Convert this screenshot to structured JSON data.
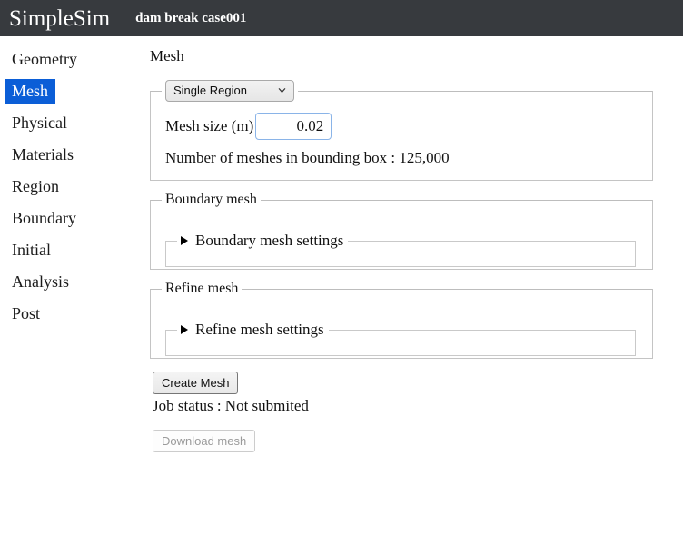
{
  "header": {
    "brand": "SimpleSim",
    "case_name": "dam break case001",
    "background": "#373a3e",
    "text_color": "#ffffff"
  },
  "sidebar": {
    "active_color": "#0b5ed7",
    "items": [
      {
        "label": "Geometry",
        "active": false
      },
      {
        "label": "Mesh",
        "active": true
      },
      {
        "label": "Physical",
        "active": false
      },
      {
        "label": "Materials",
        "active": false
      },
      {
        "label": "Region",
        "active": false
      },
      {
        "label": "Boundary",
        "active": false
      },
      {
        "label": "Initial",
        "active": false
      },
      {
        "label": "Analysis",
        "active": false
      },
      {
        "label": "Post",
        "active": false
      }
    ]
  },
  "main": {
    "page_title": "Mesh",
    "region_panel": {
      "select_value": "Single Region",
      "select_options": [
        "Single Region"
      ],
      "mesh_size_label": "Mesh size (m)",
      "mesh_size_value": "0.02",
      "mesh_size_placeholder": "0.02",
      "bounding_box_info": "Number of meshes in bounding box : 125,000"
    },
    "boundary_panel": {
      "legend": "Boundary mesh",
      "details_summary": "Boundary mesh settings",
      "expanded": false
    },
    "refine_panel": {
      "legend": "Refine mesh",
      "details_summary": "Refine mesh settings",
      "expanded": false
    },
    "actions": {
      "create_label": "Create Mesh",
      "job_status": "Job status : Not submited",
      "download_label": "Download mesh",
      "download_disabled": true
    }
  }
}
